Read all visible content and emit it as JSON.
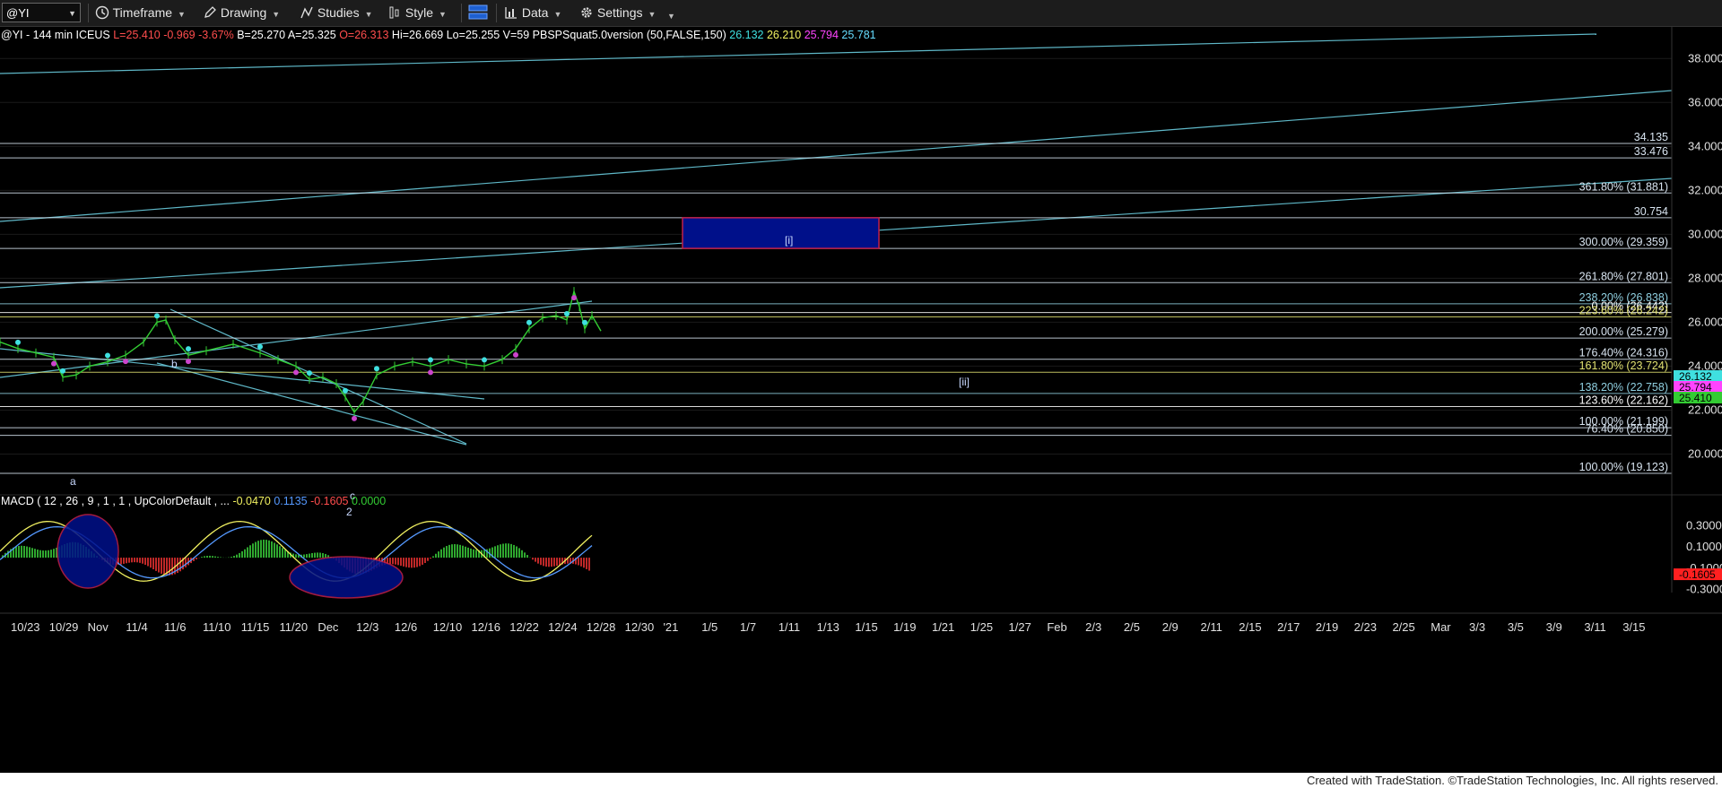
{
  "toolbar": {
    "symbol": "@YI",
    "items": [
      {
        "label": "Timeframe",
        "icon": "clock-icon"
      },
      {
        "label": "Drawing",
        "icon": "pencil-icon"
      },
      {
        "label": "Studies",
        "icon": "studies-icon"
      },
      {
        "label": "Style",
        "icon": "style-icon"
      },
      {
        "label": "Data",
        "icon": "data-icon"
      },
      {
        "label": "Settings",
        "icon": "gear-icon"
      }
    ]
  },
  "header": {
    "parts": [
      {
        "text": "@YI - 144 min  ICEUS",
        "color": "#ffffff"
      },
      {
        "text": "L=25.410  -0.969  -3.67%",
        "color": "#ff4d4d"
      },
      {
        "text": "B=25.270",
        "color": "#ffffff"
      },
      {
        "text": "A=25.325",
        "color": "#ffffff"
      },
      {
        "text": "O=26.313",
        "color": "#ff4d4d"
      },
      {
        "text": "Hi=26.669",
        "color": "#ffffff"
      },
      {
        "text": "Lo=25.255",
        "color": "#ffffff"
      },
      {
        "text": "V=59",
        "color": "#ffffff"
      },
      {
        "text": "PBSPSquat5.0version (50,FALSE,150)",
        "color": "#ffffff"
      },
      {
        "text": "26.132",
        "color": "#3fe0e0"
      },
      {
        "text": "26.210",
        "color": "#f0f060"
      },
      {
        "text": "25.794",
        "color": "#ff44ff"
      },
      {
        "text": "25.781",
        "color": "#66ddff"
      }
    ]
  },
  "macd_header": {
    "parts": [
      {
        "text": "MACD ( 12 , 26 , 9 , 1 , 1 , UpColorDefault , ...",
        "color": "#ffffff"
      },
      {
        "text": "-0.0470",
        "color": "#f0f060"
      },
      {
        "text": "0.1135",
        "color": "#5599ff"
      },
      {
        "text": "-0.1605",
        "color": "#ff4d4d"
      },
      {
        "text": "0.0000",
        "color": "#33cc33"
      }
    ]
  },
  "footer": "Created with TradeStation. ©TradeStation Technologies, Inc. All rights reserved.",
  "chart_data": [
    {
      "type": "candlestick",
      "title": "",
      "ylim": [
        19,
        38.5
      ],
      "y_ticks": [
        "38.000",
        "36.000",
        "34.000",
        "32.000",
        "30.000",
        "28.000",
        "26.000",
        "24.000",
        "22.000",
        "20.000"
      ],
      "x_ticks": [
        "10/23",
        "10/29",
        "Nov",
        "11/4",
        "11/6",
        "11/10",
        "11/15",
        "11/20",
        "Dec",
        "12/3",
        "12/6",
        "12/10",
        "12/16",
        "12/22",
        "12/24",
        "12/28",
        "12/30",
        "'21",
        "1/5",
        "1/7",
        "1/11",
        "1/13",
        "1/15",
        "1/19",
        "1/21",
        "1/25",
        "1/27",
        "Feb",
        "2/3",
        "2/5",
        "2/9",
        "2/11",
        "2/15",
        "2/17",
        "2/19",
        "2/23",
        "2/25",
        "Mar",
        "3/3",
        "3/5",
        "3/9",
        "3/11",
        "3/15"
      ],
      "price_path": [
        [
          0,
          25.1
        ],
        [
          20,
          24.8
        ],
        [
          40,
          24.6
        ],
        [
          60,
          24.4
        ],
        [
          70,
          23.5
        ],
        [
          85,
          23.6
        ],
        [
          100,
          24.0
        ],
        [
          120,
          24.2
        ],
        [
          140,
          24.5
        ],
        [
          160,
          25.1
        ],
        [
          175,
          26.0
        ],
        [
          185,
          26.1
        ],
        [
          195,
          25.2
        ],
        [
          210,
          24.5
        ],
        [
          230,
          24.7
        ],
        [
          260,
          25.0
        ],
        [
          290,
          24.6
        ],
        [
          310,
          24.3
        ],
        [
          330,
          24.0
        ],
        [
          345,
          23.4
        ],
        [
          360,
          23.5
        ],
        [
          375,
          23.2
        ],
        [
          385,
          22.6
        ],
        [
          395,
          21.9
        ],
        [
          405,
          22.4
        ],
        [
          420,
          23.6
        ],
        [
          440,
          24.0
        ],
        [
          460,
          24.2
        ],
        [
          480,
          24.0
        ],
        [
          500,
          24.3
        ],
        [
          520,
          24.1
        ],
        [
          540,
          24.0
        ],
        [
          560,
          24.3
        ],
        [
          575,
          24.8
        ],
        [
          590,
          25.7
        ],
        [
          605,
          26.2
        ],
        [
          620,
          26.3
        ],
        [
          632,
          26.1
        ],
        [
          640,
          27.4
        ],
        [
          646,
          26.7
        ],
        [
          652,
          25.7
        ],
        [
          660,
          26.3
        ],
        [
          670,
          25.6
        ]
      ],
      "last_prices": [
        {
          "text": "26.132",
          "color": "#3fe0e0"
        },
        {
          "text": "25.794",
          "color": "#ff44ff"
        },
        {
          "text": "25.410",
          "color": "#33cc33"
        }
      ],
      "fib_levels": [
        {
          "label": "34.135",
          "value": 34.135
        },
        {
          "label": "33.476",
          "value": 33.476
        },
        {
          "label": "361.80% (31.881)",
          "value": 31.881
        },
        {
          "label": "30.754",
          "value": 30.754
        },
        {
          "label": "300.00% (29.359)",
          "value": 29.359
        },
        {
          "label": "261.80% (27.801)",
          "value": 27.801
        },
        {
          "label": "238.20% (26.838)",
          "value": 26.838
        },
        {
          "label": "0.00% (26.442)",
          "value": 26.442
        },
        {
          "label": "223.60% (26.242)",
          "value": 26.242
        },
        {
          "label": "200.00% (25.279)",
          "value": 25.279
        },
        {
          "label": "176.40% (24.316)",
          "value": 24.316
        },
        {
          "label": "161.80% (23.724)",
          "value": 23.724
        },
        {
          "label": "138.20% (22.758)",
          "value": 22.758
        },
        {
          "label": "123.60% (22.162)",
          "value": 22.162
        },
        {
          "label": "100.00% (21.199)",
          "value": 21.199
        },
        {
          "label": "76.40% (20.850)",
          "value": 20.85
        },
        {
          "label": "100.00% (19.123)",
          "value": 19.123
        }
      ],
      "wave_labels": [
        {
          "text": "a"
        },
        {
          "text": "b"
        },
        {
          "text": "c"
        },
        {
          "text": "2"
        },
        {
          "text": "[i]"
        },
        {
          "text": "[ii]"
        }
      ],
      "target_box": {
        "low": 29.359,
        "high": 30.754,
        "label": "[i]"
      }
    },
    {
      "type": "line",
      "title": "MACD",
      "ylim": [
        -0.42,
        0.48
      ],
      "y_ticks": [
        "0.3000",
        "0.1000",
        "-0.1000",
        "-0.3000"
      ],
      "last_value": "-0.1605"
    }
  ],
  "colors": {
    "background": "#000000",
    "grid": "#1a1a1a",
    "level_line": "#d8e4f0",
    "trend_line": "#5fb8c8",
    "box_fill": "#00108a",
    "box_border": "#c0204a",
    "up_candle": "#33cc33",
    "wave_label": "#c8d8ff"
  }
}
